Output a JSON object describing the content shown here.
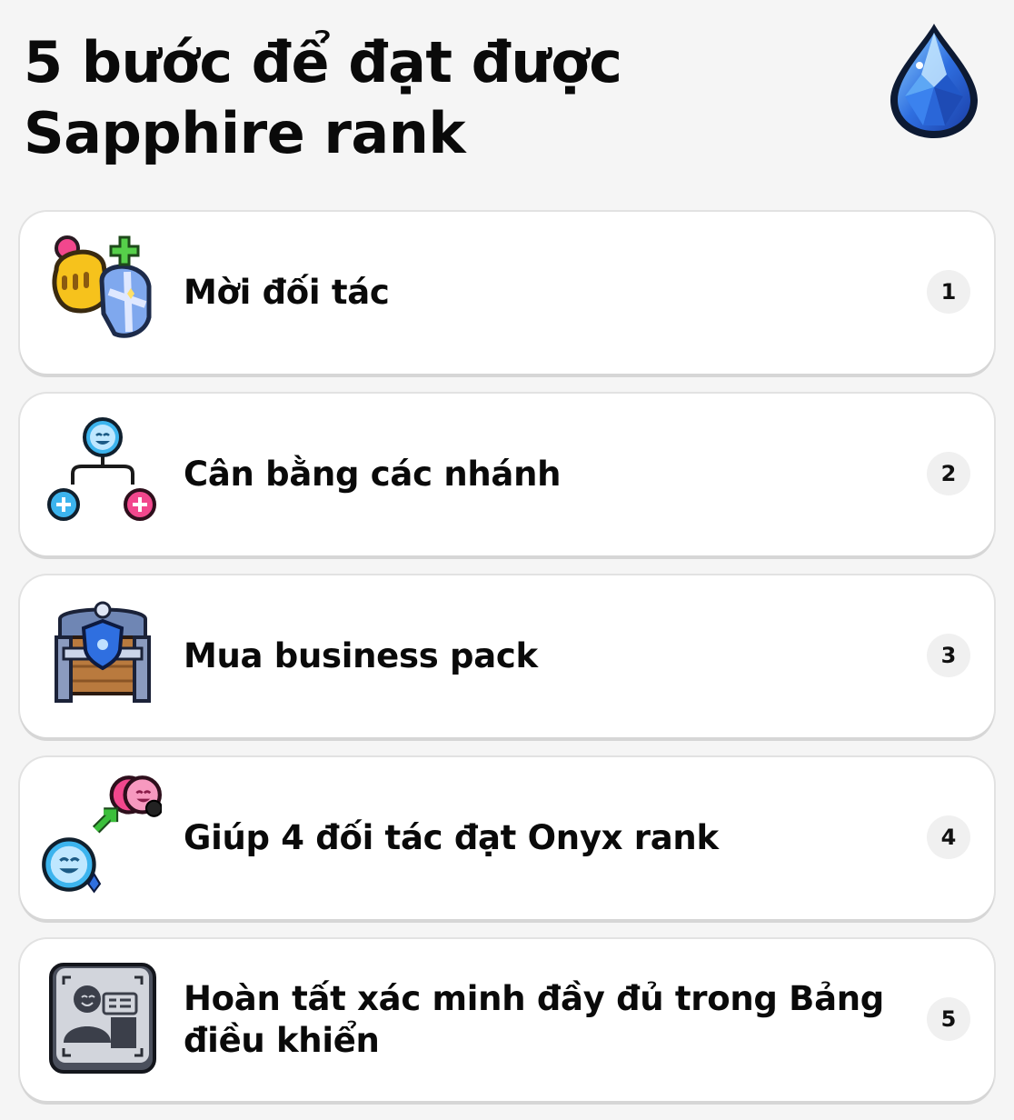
{
  "page": {
    "title": "5 bước để đạt được Sapphire rank",
    "title_icon": "sapphire-gem-icon"
  },
  "steps": [
    {
      "number": "1",
      "label": "Mời đối tác",
      "icon": "knight-helmets-plus-icon"
    },
    {
      "number": "2",
      "label": "Cân bằng các nhánh",
      "icon": "branch-tree-icon"
    },
    {
      "number": "3",
      "label": "Mua business pack",
      "icon": "treasure-chest-icon"
    },
    {
      "number": "4",
      "label": "Giúp 4 đối tác đạt Onyx rank",
      "icon": "partners-onyx-upgrade-icon"
    },
    {
      "number": "5",
      "label": "Hoàn tất xác minh đầy đủ trong Bảng điều khiển",
      "icon": "id-verification-icon"
    }
  ],
  "colors": {
    "background": "#f5f5f5",
    "card": "#ffffff",
    "sapphire": "#2f6fe0",
    "accent_blue": "#3cb4ee",
    "accent_pink": "#f2478d",
    "accent_green": "#3bbf3b"
  }
}
